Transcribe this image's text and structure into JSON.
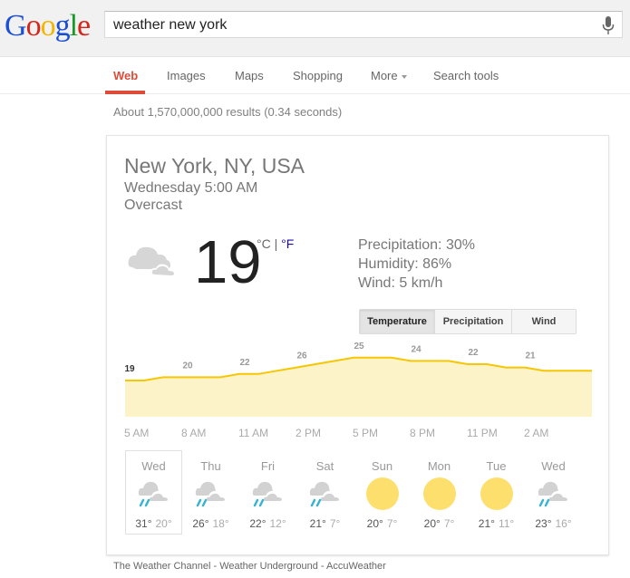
{
  "header": {
    "logo": {
      "letters": [
        "G",
        "o",
        "o",
        "g",
        "l",
        "e"
      ],
      "colors": [
        "#1a4fd6",
        "#d6251b",
        "#f2b500",
        "#1a4fd6",
        "#179928",
        "#d6251b"
      ]
    },
    "search_query": "weather new york",
    "mic_icon": "microphone-icon"
  },
  "nav": {
    "items": [
      {
        "label": "Web",
        "active": true
      },
      {
        "label": "Images"
      },
      {
        "label": "Maps"
      },
      {
        "label": "Shopping"
      },
      {
        "label": "More"
      },
      {
        "label": "Search tools"
      }
    ]
  },
  "result_stats": "About 1,570,000,000 results (0.34 seconds)",
  "weather": {
    "location": "New York, NY, USA",
    "time": "Wednesday 5:00 AM",
    "condition": "Overcast",
    "temperature": "19",
    "unit_c": "°C",
    "unit_sep": " | ",
    "unit_f": "°F",
    "precipitation": "Precipitation: 30%",
    "humidity": "Humidity: 86%",
    "wind": "Wind: 5 km/h",
    "tabs": [
      {
        "label": "Temperature",
        "selected": true
      },
      {
        "label": "Precipitation"
      },
      {
        "label": "Wind"
      }
    ],
    "accent_line": "#f6c600",
    "accent_fill": "#fdf3c9",
    "days": [
      {
        "name": "Wed",
        "icon": "rain",
        "hi": "31°",
        "lo": "20°",
        "selected": true
      },
      {
        "name": "Thu",
        "icon": "rain",
        "hi": "26°",
        "lo": "18°"
      },
      {
        "name": "Fri",
        "icon": "rain",
        "hi": "22°",
        "lo": "12°"
      },
      {
        "name": "Sat",
        "icon": "rain",
        "hi": "21°",
        "lo": "7°"
      },
      {
        "name": "Sun",
        "icon": "sun",
        "hi": "20°",
        "lo": "7°"
      },
      {
        "name": "Mon",
        "icon": "sun",
        "hi": "20°",
        "lo": "7°"
      },
      {
        "name": "Tue",
        "icon": "sun",
        "hi": "21°",
        "lo": "11°"
      },
      {
        "name": "Wed",
        "icon": "rain",
        "hi": "23°",
        "lo": "16°"
      }
    ]
  },
  "chart_data": {
    "type": "area",
    "title": "Temperature",
    "xlabel": "",
    "ylabel": "°C",
    "x_tick_labels": [
      "5 AM",
      "8 AM",
      "11 AM",
      "2 PM",
      "5 PM",
      "8 PM",
      "11 PM",
      "2 AM"
    ],
    "hourly_values": [
      19,
      19,
      20,
      20,
      20,
      20,
      21,
      21,
      22,
      23,
      24,
      25,
      26,
      26,
      26,
      25,
      25,
      25,
      24,
      24,
      23,
      23,
      22,
      22,
      22,
      21,
      21,
      21,
      21
    ],
    "data_labels": [
      {
        "hour_index": 0,
        "value": "19"
      },
      {
        "hour_index": 3,
        "value": "20"
      },
      {
        "hour_index": 6,
        "value": "22"
      },
      {
        "hour_index": 9,
        "value": "26"
      },
      {
        "hour_index": 12,
        "value": "25"
      },
      {
        "hour_index": 15,
        "value": "24"
      },
      {
        "hour_index": 18,
        "value": "22"
      },
      {
        "hour_index": 21,
        "value": "21"
      }
    ],
    "ylim": [
      0,
      28
    ],
    "grid": false
  },
  "sources": "The Weather Channel - Weather Underground - AccuWeather"
}
